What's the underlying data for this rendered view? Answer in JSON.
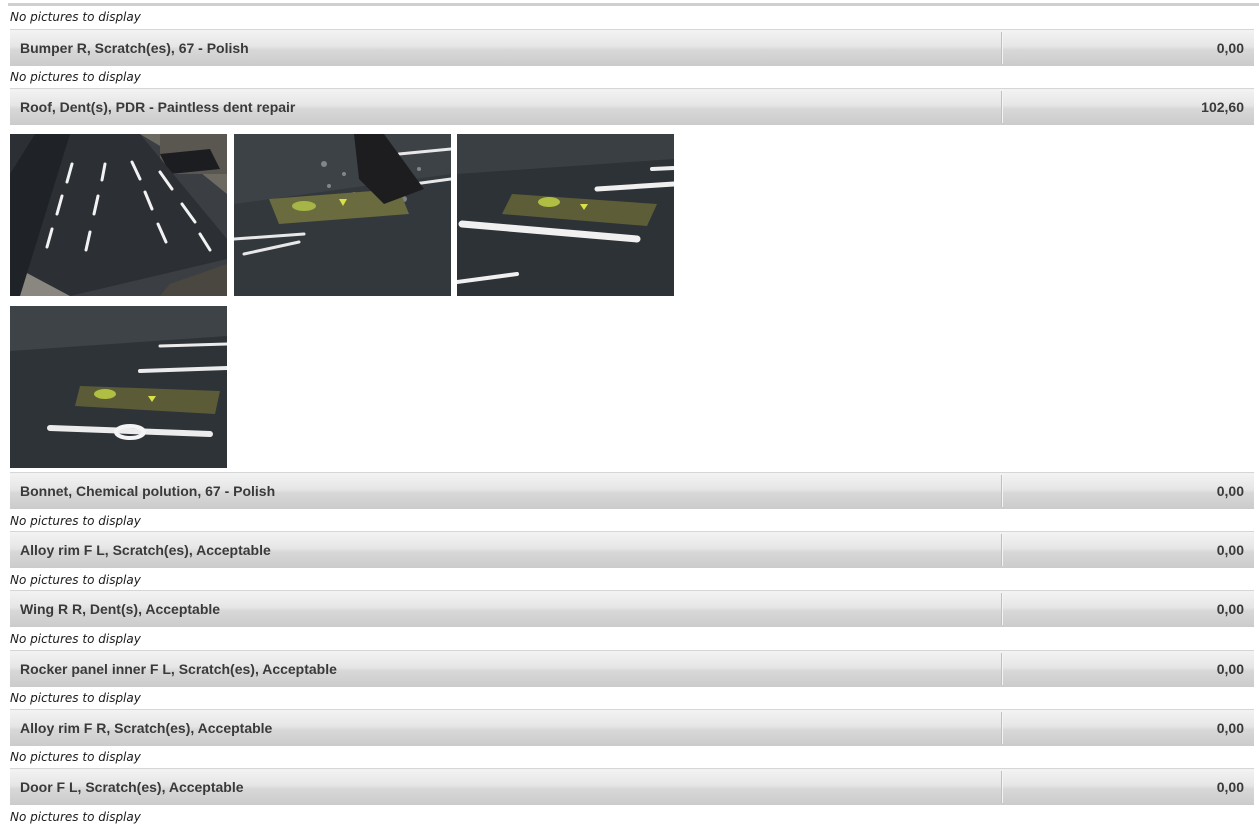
{
  "no_pictures_text": "No pictures to display",
  "items": [
    {
      "label": "Bumper R, Scratch(es), 67 - Polish",
      "amount": "0,00"
    },
    {
      "label": "Roof, Dent(s), PDR - Paintless dent repair",
      "amount": "102,60"
    },
    {
      "label": "Bonnet, Chemical polution, 67 - Polish",
      "amount": "0,00"
    },
    {
      "label": "Alloy rim F L, Scratch(es), Acceptable",
      "amount": "0,00"
    },
    {
      "label": "Wing R R, Dent(s), Acceptable",
      "amount": "0,00"
    },
    {
      "label": "Rocker panel inner F L, Scratch(es), Acceptable",
      "amount": "0,00"
    },
    {
      "label": "Alloy rim F R, Scratch(es), Acceptable",
      "amount": "0,00"
    },
    {
      "label": "Door F L, Scratch(es), Acceptable",
      "amount": "0,00"
    }
  ],
  "roof_photos": [
    {
      "name": "roof-photo-1",
      "subject": "car roof under garage lights"
    },
    {
      "name": "roof-photo-2",
      "subject": "pdr glue tab being pulled"
    },
    {
      "name": "roof-photo-3",
      "subject": "pdr glue tab on roof"
    },
    {
      "name": "roof-photo-4",
      "subject": "pdr glue tab close-up"
    }
  ]
}
